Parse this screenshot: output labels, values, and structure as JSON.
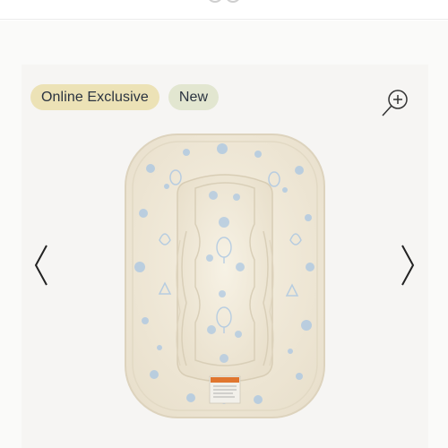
{
  "badges": {
    "online_exclusive": "Online Exclusive",
    "new": "New"
  },
  "icons": {
    "zoom": "zoom-in-icon",
    "prev": "chevron-left-icon",
    "next": "chevron-right-icon"
  },
  "colors": {
    "badge_online_bg": "#ece2b6",
    "badge_new_bg": "#e2e6d0",
    "product_fabric": "#f3ecdc",
    "product_print": "#a9c6e3"
  }
}
